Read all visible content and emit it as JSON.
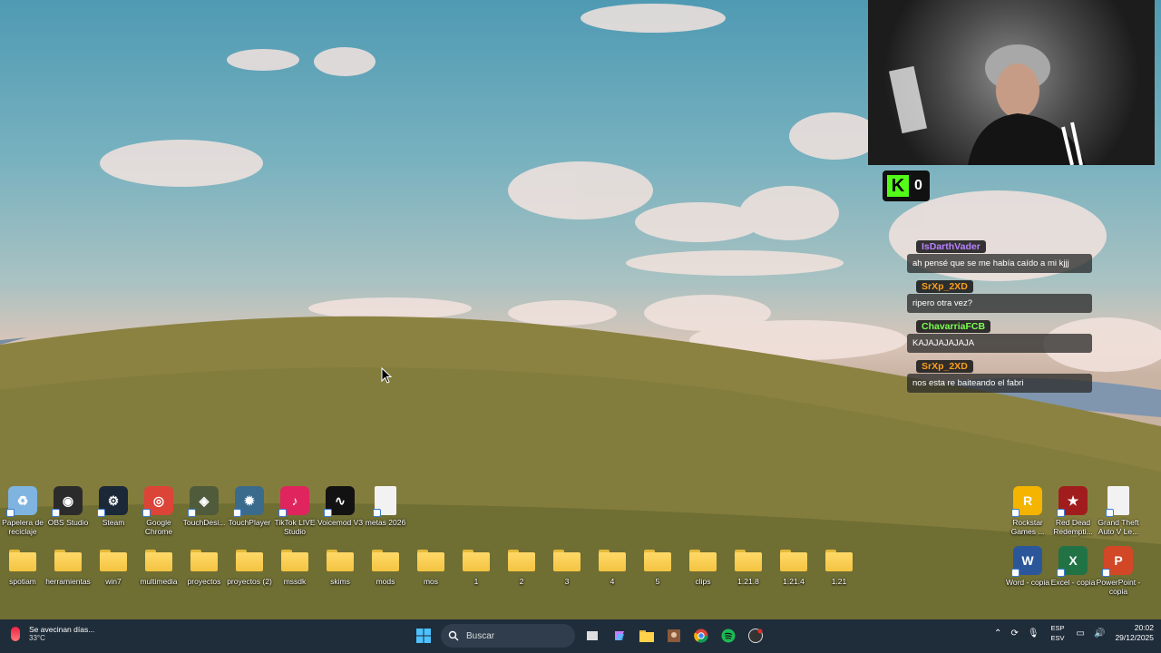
{
  "desktop": {
    "top_icons": [
      {
        "name": "recycle-bin-icon",
        "label": "Papelera de reciclaje",
        "color": "#7fb3e0",
        "glyph": "♻"
      },
      {
        "name": "obs-icon",
        "label": "OBS Studio",
        "color": "#2b2b2b",
        "glyph": "◉"
      },
      {
        "name": "steam-icon",
        "label": "Steam",
        "color": "#1b2838",
        "glyph": "⚙"
      },
      {
        "name": "chrome-icon",
        "label": "Google Chrome",
        "color": "#db4437",
        "glyph": "◎"
      },
      {
        "name": "touchdesigner-icon",
        "label": "TouchDesi...",
        "color": "#4f5b3a",
        "glyph": "◈"
      },
      {
        "name": "touchplayer-icon",
        "label": "TouchPlayer",
        "color": "#3a6b8c",
        "glyph": "✹"
      },
      {
        "name": "tiktok-live-icon",
        "label": "TikTok LIVE Studio",
        "color": "#e0245e",
        "glyph": "♪"
      },
      {
        "name": "voicemod-icon",
        "label": "Voicemod V3",
        "color": "#121212",
        "glyph": "∿"
      },
      {
        "name": "text-file-icon",
        "label": "metas 2026",
        "color": "#f2f2f2",
        "glyph": ""
      }
    ],
    "folders": [
      "spotiam",
      "herramientas",
      "win7",
      "multimedia",
      "proyectos",
      "proyectos (2)",
      "mssdk",
      "skims",
      "mods",
      "mos",
      "1",
      "2",
      "3",
      "4",
      "5",
      "clips",
      "1.21.8",
      "1.21.4",
      "1.21"
    ],
    "right_icons_top": [
      {
        "name": "rockstar-icon",
        "label": "Rockstar Games ...",
        "color": "#f4b400",
        "glyph": "R"
      },
      {
        "name": "rdr2-icon",
        "label": "Red Dead Redempti...",
        "color": "#a11d1d",
        "glyph": "★"
      },
      {
        "name": "gta-file-icon",
        "label": "Grand Theft Auto V Le...",
        "color": "#f2f2f2",
        "glyph": ""
      }
    ],
    "right_icons_bottom": [
      {
        "name": "word-icon",
        "label": "Word - copia",
        "color": "#2b579a",
        "glyph": "W"
      },
      {
        "name": "excel-icon",
        "label": "Excel - copia",
        "color": "#217346",
        "glyph": "X"
      },
      {
        "name": "powerpoint-icon",
        "label": "PowerPoint - copia",
        "color": "#d24726",
        "glyph": "P"
      }
    ]
  },
  "overlay": {
    "kick_count": "0",
    "chat": [
      {
        "user": "IsDarthVader",
        "user_color": "#b983ff",
        "text": "ah pensé que se me había caído a mi kjjj"
      },
      {
        "user": "SrXp_2XD",
        "user_color": "#ff9f1a",
        "text": "ripero otra vez?"
      },
      {
        "user": "ChavarriaFCB",
        "user_color": "#7cff4f",
        "text": "KAJAJAJAJAJA"
      },
      {
        "user": "SrXp_2XD",
        "user_color": "#ff9f1a",
        "text": "nos esta re baiteando el fabri"
      }
    ]
  },
  "taskbar": {
    "weather_text": "Se avecinan días...",
    "temperature": "33°C",
    "search_placeholder": "Buscar",
    "language_line1": "ESP",
    "language_line2": "ESV",
    "time": "20:02",
    "date": "29/12/2025"
  }
}
